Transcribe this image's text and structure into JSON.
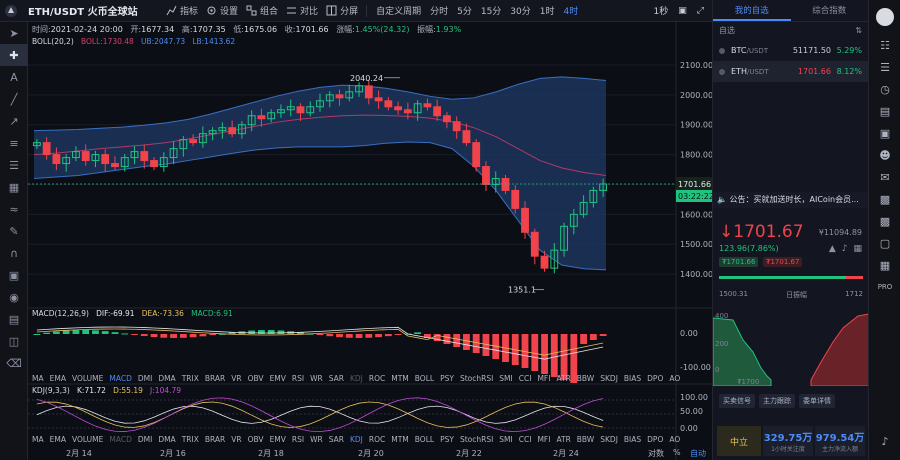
{
  "topbar": {
    "pair": "ETH/USDT 火币全球站",
    "buttons": [
      "指标",
      "设置",
      "组合",
      "对比",
      "分屏"
    ],
    "custom_period": "自定义周期",
    "timeframes": [
      "分时",
      "5分",
      "15分",
      "30分",
      "1时",
      "4时"
    ],
    "active_timeframe": "4时",
    "right_label": "1秒"
  },
  "info": {
    "time_label": "时间:",
    "time": "2021-02-24 20:00",
    "open_label": "开:",
    "open": "1677.34",
    "high_label": "高:",
    "high": "1707.35",
    "low_label": "低:",
    "low": "1675.06",
    "close_label": "收:",
    "close": "1701.66",
    "change_label": "涨幅:",
    "change": "1.45%(24.32)",
    "amp_label": "振幅:",
    "amp": "1.93%"
  },
  "boll": {
    "name": "BOLL(20,2)",
    "boll_label": "BOLL:",
    "boll": "1730.48",
    "ub_label": "UB:",
    "ub": "2047.73",
    "lb_label": "LB:",
    "lb": "1413.62"
  },
  "macd": {
    "name": "MACD(12,26,9)",
    "dif_label": "DIF:",
    "dif": "-69.91",
    "dea_label": "DEA:",
    "dea": "-73.36",
    "macd_label": "MACD:",
    "macd": "6.91"
  },
  "kdj": {
    "name": "KDJ(9,3,3)",
    "k_label": "K:",
    "k": "71.72",
    "d_label": "D:",
    "d": "55.19",
    "j_label": "J:",
    "j": "104.79"
  },
  "indicators_row1": [
    "MA",
    "EMA",
    "VOLUME",
    "MACD",
    "DMI",
    "DMA",
    "TRIX",
    "BRAR",
    "VR",
    "OBV",
    "EMV",
    "RSI",
    "WR",
    "SAR",
    "KDJ",
    "ROC",
    "MTM",
    "BOLL",
    "PSY",
    "StochRSI",
    "SMI",
    "CCI",
    "MFI",
    "ATR",
    "BBW",
    "SKDJ",
    "BIAS",
    "DPO",
    "AO"
  ],
  "indicators_row2": [
    "MA",
    "EMA",
    "VOLUME",
    "MACD",
    "DMI",
    "DMA",
    "TRIX",
    "BRAR",
    "VR",
    "OBV",
    "EMV",
    "RSI",
    "WR",
    "SAR",
    "KDJ",
    "ROC",
    "MTM",
    "BOLL",
    "PSY",
    "StochRSI",
    "SMI",
    "CCI",
    "MFI",
    "ATR",
    "BBW",
    "SKDJ",
    "BIAS",
    "DPO",
    "AO"
  ],
  "price_axis": [
    "2100.00",
    "2000.00",
    "1900.00",
    "1800.00",
    "1700.00",
    "1600.00",
    "1500.00",
    "1400.00"
  ],
  "macd_axis": [
    "0.00",
    "-100.00"
  ],
  "kdj_axis": [
    "100.00",
    "50.00",
    "0.00"
  ],
  "last_price_tag": "1701.66",
  "countdown_tag": "03:22:22",
  "high_marker": "2040.24",
  "low_marker": "1351.1",
  "date_axis": [
    "2月 14",
    "2月 16",
    "2月 18",
    "2月 20",
    "2月 22",
    "2月 24"
  ],
  "bottom": {
    "scale": "对数",
    "percent": "%",
    "auto": "自动"
  },
  "colors": {
    "up": "#1fc37e",
    "down": "#f0434b",
    "accent": "#4c8bf5",
    "band": "#1d3a66"
  },
  "chart_data": {
    "type": "candlestick",
    "x": [
      "2月 14",
      "2月 16",
      "2月 18",
      "2月 20",
      "2月 22",
      "2月 24"
    ],
    "ylim": [
      1300,
      2150
    ],
    "high": 2040.24,
    "low": 1351.1,
    "last": 1701.66,
    "boll_mid": [
      1800,
      1805,
      1812,
      1820,
      1826,
      1832,
      1840,
      1852,
      1866,
      1880,
      1894,
      1908,
      1918,
      1925,
      1930,
      1932,
      1931,
      1928,
      1922,
      1910,
      1890,
      1860,
      1820,
      1780,
      1755,
      1740,
      1730
    ],
    "boll_ub": [
      1880,
      1882,
      1884,
      1888,
      1892,
      1898,
      1906,
      1918,
      1935,
      1955,
      1975,
      1995,
      2012,
      2025,
      2032,
      2030,
      2022,
      2010,
      1995,
      1985,
      1990,
      2010,
      2035,
      2055,
      2060,
      2055,
      2048
    ],
    "boll_lb": [
      1720,
      1725,
      1730,
      1740,
      1750,
      1760,
      1768,
      1780,
      1792,
      1804,
      1815,
      1822,
      1826,
      1826,
      1826,
      1830,
      1838,
      1842,
      1840,
      1820,
      1760,
      1680,
      1580,
      1480,
      1430,
      1418,
      1414
    ],
    "closes": [
      1840,
      1800,
      1770,
      1790,
      1810,
      1780,
      1800,
      1770,
      1760,
      1790,
      1810,
      1780,
      1760,
      1790,
      1820,
      1850,
      1840,
      1870,
      1880,
      1890,
      1870,
      1900,
      1930,
      1920,
      1940,
      1950,
      1960,
      1940,
      1960,
      1980,
      2000,
      1990,
      2010,
      2030,
      1990,
      1980,
      1960,
      1950,
      1940,
      1970,
      1960,
      1930,
      1910,
      1880,
      1840,
      1760,
      1700,
      1720,
      1680,
      1620,
      1540,
      1460,
      1420,
      1480,
      1560,
      1600,
      1640,
      1680,
      1701.66
    ]
  },
  "right_panel": {
    "tabs": [
      "我的自选",
      "综合指数"
    ],
    "active_tab": "我的自选",
    "list_header": "自选",
    "watchlist": [
      {
        "sym": "BTC",
        "quote": "/USDT",
        "price": "51171.50",
        "change": "5.29%"
      },
      {
        "sym": "ETH",
        "quote": "/USDT",
        "price": "1701.66",
        "change": "8.12%"
      }
    ],
    "notice": "公告：买就加送时长，AICoin会员...",
    "big_price": "1701.67",
    "sub_price": "¥11094.89",
    "change_line": "123.96(7.86%)",
    "tag_green": "₮1701.66",
    "tag_red": "₮1701.67",
    "range_low": "1500.31",
    "range_mid": "日振幅",
    "range_high": "1712",
    "range_fill_pct": 88,
    "depth_labels": [
      "400",
      "200",
      "0"
    ],
    "depth_x": "₮1700",
    "buttons": [
      "买卖信号",
      "主力跟踪",
      "委单详情"
    ],
    "flow_label": "中立",
    "flow_in": "329.75万",
    "flow_in_label": "1小时关注度",
    "flow_main": "979.54万",
    "flow_main_label": "主力净流入额"
  }
}
